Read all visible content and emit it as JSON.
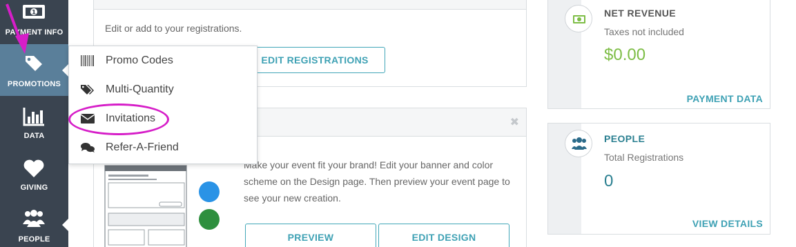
{
  "sidebar": {
    "items": [
      {
        "label": "PAYMENT INFO",
        "icon": "money-icon"
      },
      {
        "label": "PROMOTIONS",
        "icon": "tag-icon"
      },
      {
        "label": "DATA",
        "icon": "bar-chart-icon"
      },
      {
        "label": "GIVING",
        "icon": "heart-icon"
      },
      {
        "label": "PEOPLE",
        "icon": "users-icon"
      }
    ]
  },
  "dropdown": {
    "items": [
      {
        "label": "Promo Codes",
        "icon": "barcode-icon"
      },
      {
        "label": "Multi-Quantity",
        "icon": "tags-icon"
      },
      {
        "label": "Invitations",
        "icon": "envelope-icon"
      },
      {
        "label": "Refer-A-Friend",
        "icon": "comments-icon"
      }
    ]
  },
  "registrations_card": {
    "text": "Edit or add to your registrations.",
    "button": "EDIT REGISTRATIONS"
  },
  "design_card": {
    "text": "Make your event fit your brand! Edit your banner and color scheme on the Design page. Then preview your event page to see your new creation.",
    "preview_button": "PREVIEW",
    "edit_button": "EDIT DESIGN",
    "close_glyph": "✖"
  },
  "revenue_card": {
    "title": "NET REVENUE",
    "subtitle": "Taxes not included",
    "value": "$0.00",
    "link": "PAYMENT DATA"
  },
  "people_card": {
    "title": "PEOPLE",
    "subtitle": "Total Registrations",
    "value": "0",
    "link": "VIEW DETAILS"
  },
  "colors": {
    "sidebar": "#3a4450",
    "active": "#5a7f9a",
    "accent": "#3ea1b4",
    "revenue": "#7dbd45",
    "annotation": "#d61ec8"
  }
}
